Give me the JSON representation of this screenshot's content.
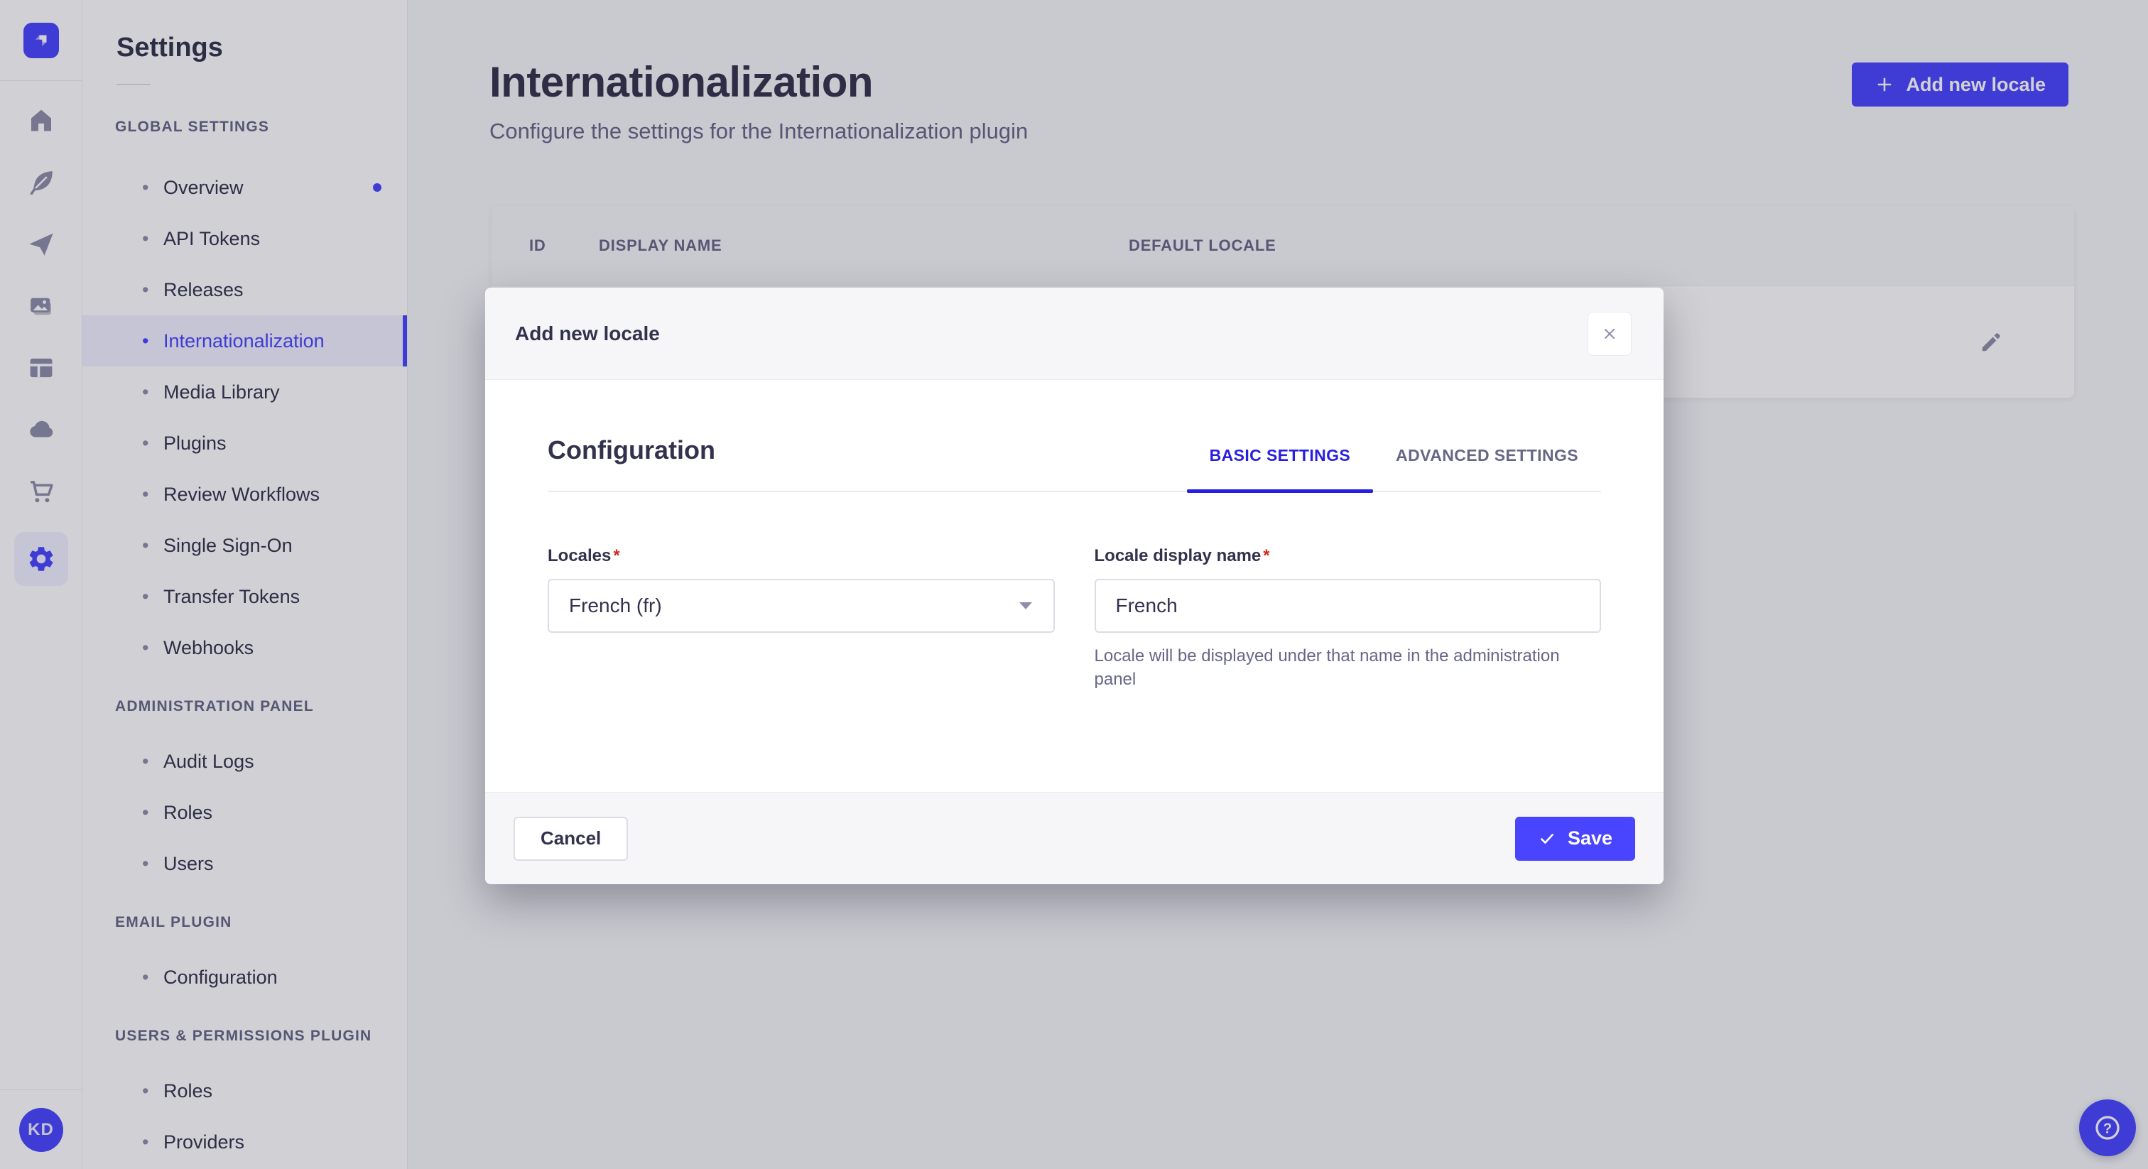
{
  "colors": {
    "primary": "#4945FF",
    "primary_light_bg": "#F0F0FF",
    "tab_active": "#271FE0",
    "danger": "#D02B20",
    "text": "#32324D",
    "muted": "#666687"
  },
  "nav_rail": {
    "logo_icon": "strapi-logo",
    "icons": [
      "home",
      "feather",
      "paper-plane",
      "media",
      "layout",
      "cloud",
      "cart",
      "settings"
    ],
    "active_icon": "settings",
    "avatar_initials": "KD"
  },
  "icons": {
    "bullet": "•"
  },
  "sidebar": {
    "title": "Settings",
    "sections": [
      {
        "label": "GLOBAL SETTINGS",
        "items": [
          {
            "label": "Overview",
            "notification": true
          },
          {
            "label": "API Tokens"
          },
          {
            "label": "Releases"
          },
          {
            "label": "Internationalization",
            "active": true
          },
          {
            "label": "Media Library"
          },
          {
            "label": "Plugins"
          },
          {
            "label": "Review Workflows"
          },
          {
            "label": "Single Sign-On"
          },
          {
            "label": "Transfer Tokens"
          },
          {
            "label": "Webhooks"
          }
        ]
      },
      {
        "label": "ADMINISTRATION PANEL",
        "items": [
          {
            "label": "Audit Logs"
          },
          {
            "label": "Roles"
          },
          {
            "label": "Users"
          }
        ]
      },
      {
        "label": "EMAIL PLUGIN",
        "items": [
          {
            "label": "Configuration"
          }
        ]
      },
      {
        "label": "USERS & PERMISSIONS PLUGIN",
        "items": [
          {
            "label": "Roles"
          },
          {
            "label": "Providers"
          }
        ]
      }
    ]
  },
  "page": {
    "title": "Internationalization",
    "subtitle": "Configure the settings for the Internationalization plugin",
    "add_button_label": "Add new locale"
  },
  "table": {
    "columns": [
      "ID",
      "DISPLAY NAME",
      "DEFAULT LOCALE"
    ]
  },
  "modal": {
    "title": "Add new locale",
    "section_title": "Configuration",
    "tabs": [
      {
        "label": "BASIC SETTINGS",
        "active": true
      },
      {
        "label": "ADVANCED SETTINGS",
        "active": false
      }
    ],
    "fields": {
      "locales": {
        "label": "Locales",
        "required": "*",
        "value": "French (fr)"
      },
      "display_name": {
        "label": "Locale display name",
        "required": "*",
        "value": "French",
        "help": "Locale will be displayed under that name in the administration panel"
      }
    },
    "footer": {
      "cancel_label": "Cancel",
      "save_label": "Save"
    }
  }
}
